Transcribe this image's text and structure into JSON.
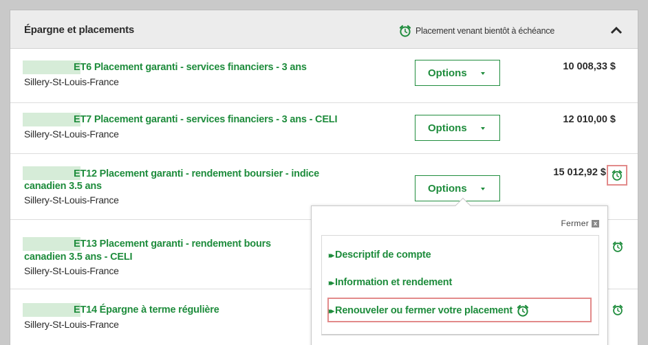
{
  "panel": {
    "title": "Épargne et placements",
    "legend_text": "Placement venant bientôt à échéance",
    "collapse_icon": "chevron-up-icon"
  },
  "rows": [
    {
      "name": "ET6 Placement garanti - services financiers - 3 ans",
      "branch": "Sillery-St-Louis-France",
      "options_label": "Options",
      "amount": "10 008,33 $"
    },
    {
      "name": "ET7 Placement garanti - services financiers - 3 ans - CELI",
      "branch": "Sillery-St-Louis-France",
      "options_label": "Options",
      "amount": "12 010,00 $"
    },
    {
      "name_line1": "ET12 Placement garanti - rendement boursier - indice",
      "name_line2": "canadien 3.5 ans",
      "branch": "Sillery-St-Louis-France",
      "options_label": "Options",
      "amount": "15 012,92 $"
    },
    {
      "name_line1": "ET13 Placement garanti - rendement bours",
      "name_line2": "canadien 3.5 ans - CELI",
      "branch": "Sillery-St-Louis-France"
    },
    {
      "name": "ET14 Épargne à terme régulière",
      "branch": "Sillery-St-Louis-France"
    }
  ],
  "popup": {
    "close_label": "Fermer",
    "close_icon": "x",
    "items": [
      "Descriptif de compte",
      "Information et rendement",
      "Renouveler ou fermer votre placement"
    ]
  },
  "colors": {
    "accent_green": "#1e8c3c",
    "highlight_red": "#e28a8a",
    "header_bg": "#ececec"
  }
}
